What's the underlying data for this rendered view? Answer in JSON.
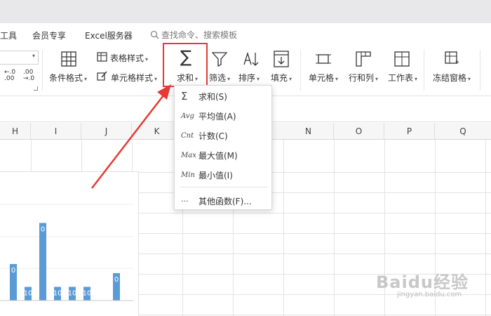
{
  "menubar": {
    "items": [
      "工具",
      "会员专享",
      "Excel服务器"
    ],
    "search_placeholder": "查找命令、搜索模板"
  },
  "ribbon": {
    "number_format_small": [
      ".00",
      ".00"
    ],
    "conditional_format": "条件格式",
    "table_style": "表格样式",
    "cell_style": "单元格样式",
    "sum": "求和",
    "filter": "筛选",
    "sort": "排序",
    "fill": "填充",
    "cell": "单元格",
    "row_col": "行和列",
    "worksheet": "工作表",
    "freeze": "冻结窗格"
  },
  "columns": [
    "H",
    "I",
    "J",
    "K",
    "N",
    "O",
    "P",
    "Q"
  ],
  "dropdown": {
    "items": [
      {
        "icon": "Σ",
        "label": "求和(S)"
      },
      {
        "icon": "Avg",
        "label": "平均值(A)"
      },
      {
        "icon": "Cnt",
        "label": "计数(C)"
      },
      {
        "icon": "Max",
        "label": "最大值(M)"
      },
      {
        "icon": "Min",
        "label": "最小值(I)"
      }
    ],
    "more_icon": "···",
    "more_label": "其他函数(F)..."
  },
  "chart_data": {
    "type": "bar",
    "categories": [
      "",
      "",
      "",
      "",
      "",
      "",
      "",
      ""
    ],
    "values": [
      0.4,
      0.15,
      0.85,
      0.15,
      0.15,
      0.15,
      0.0,
      0.3
    ],
    "value_labels": [
      "0",
      "10",
      "0",
      "10",
      "10",
      "10",
      "",
      "0"
    ],
    "color": "#5b9bd5"
  },
  "watermark": {
    "brand": "Baidu经验",
    "url": "jingyan.baidu.com"
  },
  "colors": {
    "highlight": "#e53935",
    "bar": "#5b9bd5"
  }
}
